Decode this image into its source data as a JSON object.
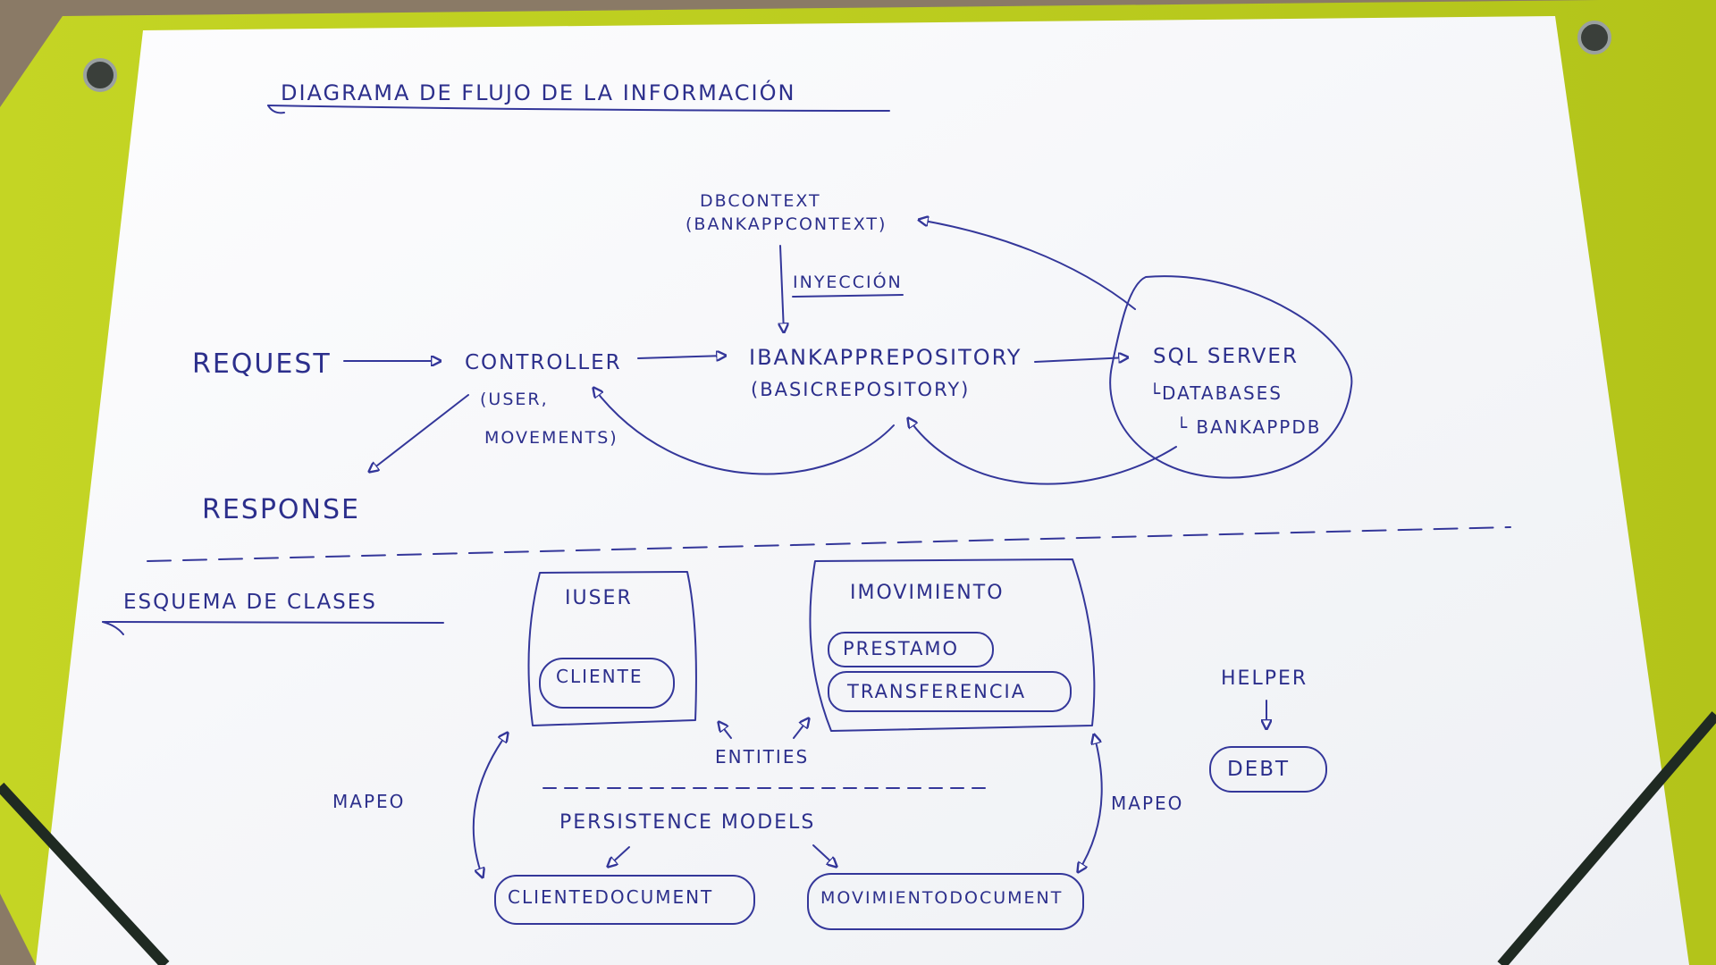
{
  "colors": {
    "ink": "#2c2f8c",
    "paper": "#fbfbfd",
    "folder": "#bccf1e",
    "table": "#8a7a66"
  },
  "title": "DIAGRAMA DE FLUJO DE LA INFORMACIÓN",
  "flow": {
    "dbcontext": "DBCONTEXT",
    "dbcontext_sub": "(BANKAPPCONTEXT)",
    "injection": "INYECCIÓN",
    "request": "REQUEST",
    "controller": "CONTROLLER",
    "controller_sub1": "(USER,",
    "controller_sub2": "MOVEMENTS)",
    "repository": "IBANKAPPREPOSITORY",
    "repository_sub": "(BASICREPOSITORY)",
    "sql_server": "SQL SERVER",
    "databases": "└DATABASES",
    "bankappdb": "└ BANKAPPDB",
    "response": "RESPONSE"
  },
  "classes": {
    "title": "ESQUEMA DE CLASES",
    "iuser": "IUSER",
    "cliente": "CLIENTE",
    "imovimiento": "IMOVIMIENTO",
    "prestamo": "PRESTAMO",
    "transferencia": "TRANSFERENCIA",
    "entities": "ENTITIES",
    "helper": "HELPER",
    "debt": "DEBT",
    "mapeo_left": "MAPEO",
    "mapeo_right": "MAPEO",
    "persistence": "PERSISTENCE MODELS",
    "cliente_document": "CLIENTEDOCUMENT",
    "movimiento_document": "MOVIMIENTODOCUMENT"
  }
}
